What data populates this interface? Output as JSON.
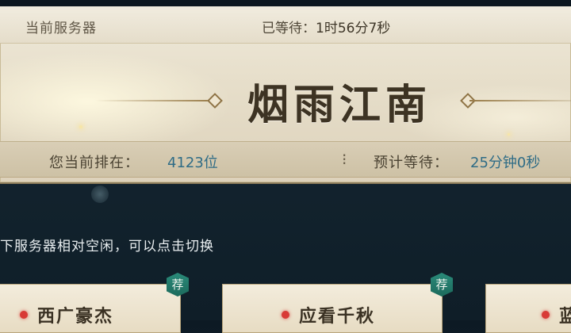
{
  "header": {
    "current_server_label": "当前服务器",
    "waited_label": "已等待：",
    "waited_value": "1时56分7秒"
  },
  "server": {
    "name": "烟雨江南"
  },
  "queue": {
    "rank_label": "您当前排在：",
    "rank_value": "4123位",
    "separator": "⁝",
    "estimate_label": "预计等待：",
    "estimate_value": "25分钟0秒"
  },
  "hint": {
    "text": "下服务器相对空闲，可以点击切换"
  },
  "recommended": {
    "badge_label": "荐",
    "cards": [
      {
        "name": "西广豪杰",
        "status_color": "#d83a36",
        "recommended": true
      },
      {
        "name": "应看千秋",
        "status_color": "#d83a36",
        "recommended": true
      },
      {
        "name": "蓝",
        "status_color": "#d83a36",
        "recommended": false
      }
    ]
  },
  "colors": {
    "accent_value": "#2f6c86",
    "badge_green": "#1c6a5c",
    "status_red": "#d83a36"
  }
}
